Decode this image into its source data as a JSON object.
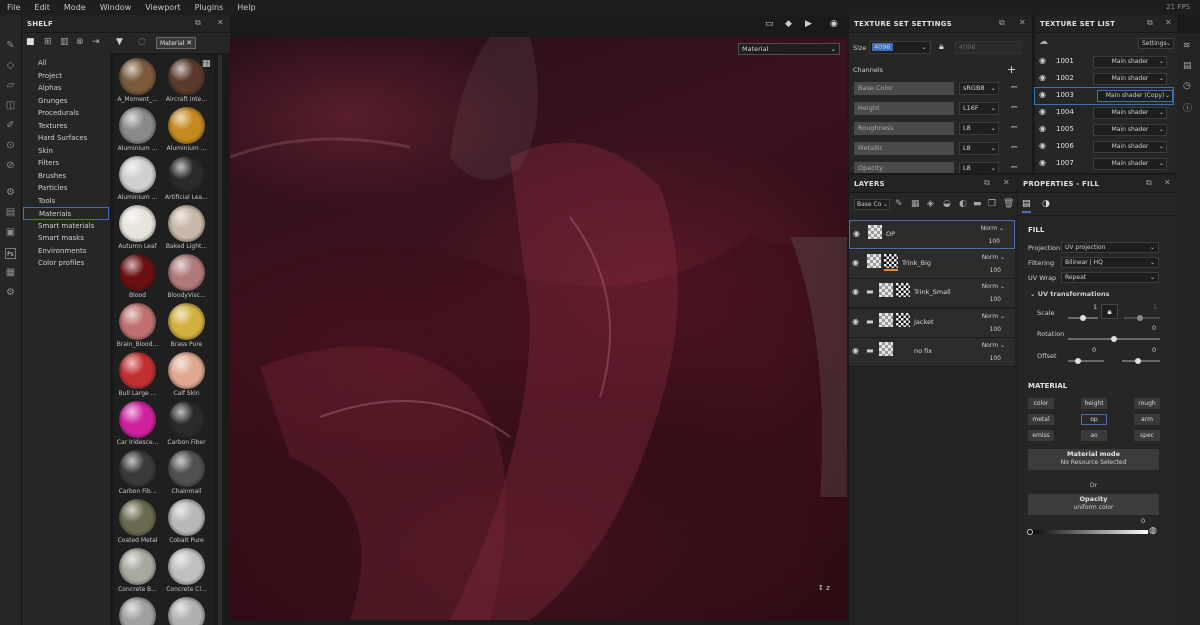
{
  "menu": [
    "File",
    "Edit",
    "Mode",
    "Window",
    "Viewport",
    "Plugins",
    "Help"
  ],
  "fps": "21 FPS",
  "shelf": {
    "title": "SHELF",
    "filter_tag": "Material",
    "categories": [
      "All",
      "Project",
      "Alphas",
      "Grunges",
      "Procedurals",
      "Textures",
      "Hard Surfaces",
      "Skin",
      "Filters",
      "Brushes",
      "Particles",
      "Tools",
      "Materials",
      "Smart materials",
      "Smart masks",
      "Environments",
      "Color profiles"
    ],
    "selected_category": "Materials",
    "materials": [
      {
        "name": "A_Moment_...",
        "color": "#7a5a3a"
      },
      {
        "name": "Aircraft Inte...",
        "color": "#5a3a2a"
      },
      {
        "name": "Aluminium ...",
        "color": "#8a8a8a"
      },
      {
        "name": "Aluminium ...",
        "color": "#c48a20"
      },
      {
        "name": "Aluminium ...",
        "color": "#d0d0d0"
      },
      {
        "name": "Artificial Lea...",
        "color": "#2a2a2a"
      },
      {
        "name": "Autumn Leaf",
        "color": "#e8e4dc"
      },
      {
        "name": "Baked Light...",
        "color": "#c8b8a8"
      },
      {
        "name": "Blood",
        "color": "#6a1010"
      },
      {
        "name": "BloodyVisc...",
        "color": "#b07a7a"
      },
      {
        "name": "Brain_Blood...",
        "color": "#c07070"
      },
      {
        "name": "Brass Pure",
        "color": "#d4b040"
      },
      {
        "name": "Bull Large ...",
        "color": "#c03030"
      },
      {
        "name": "Calf Skin",
        "color": "#e0a890"
      },
      {
        "name": "Car Iridesce...",
        "color": "#d020a0"
      },
      {
        "name": "Carbon Fiber",
        "color": "#2a2a2a"
      },
      {
        "name": "Carbon Fib...",
        "color": "#3a3a3a"
      },
      {
        "name": "Chainmail",
        "color": "#505050"
      },
      {
        "name": "Coated Metal",
        "color": "#6a6a50"
      },
      {
        "name": "Cobalt Pure",
        "color": "#b8b8b8"
      },
      {
        "name": "Concrete B...",
        "color": "#a8a8a0"
      },
      {
        "name": "Concrete Cl...",
        "color": "#c0c0c0"
      },
      {
        "name": "",
        "color": "#a0a0a0"
      },
      {
        "name": "",
        "color": "#b0b0b0"
      }
    ]
  },
  "viewport": {
    "channel": "Material"
  },
  "texture_set_settings": {
    "title": "TEXTURE SET SETTINGS",
    "size_label": "Size",
    "size_value": "4096",
    "size_linked": "4096",
    "channels_label": "Channels",
    "channels": [
      {
        "name": "Base Color",
        "format": "sRGB8"
      },
      {
        "name": "Height",
        "format": "L16F"
      },
      {
        "name": "Roughness",
        "format": "L8"
      },
      {
        "name": "Metallic",
        "format": "L8"
      },
      {
        "name": "Opacity",
        "format": "L8"
      }
    ]
  },
  "texture_set_list": {
    "title": "TEXTURE SET LIST",
    "settings_label": "Settings",
    "sets": [
      {
        "name": "1001",
        "shader": "Main shader"
      },
      {
        "name": "1002",
        "shader": "Main shader"
      },
      {
        "name": "1003",
        "shader": "Main shader (Copy)"
      },
      {
        "name": "1004",
        "shader": "Main shader"
      },
      {
        "name": "1005",
        "shader": "Main shader"
      },
      {
        "name": "1006",
        "shader": "Main shader"
      },
      {
        "name": "1007",
        "shader": "Main shader"
      }
    ],
    "selected": "1003"
  },
  "layers": {
    "title": "LAYERS",
    "channel_select": "Base Co",
    "items": [
      {
        "name": "OP",
        "blend": "Norm",
        "opacity": "100",
        "folder": false
      },
      {
        "name": "Trink_Big",
        "blend": "Norm",
        "opacity": "100",
        "folder": false
      },
      {
        "name": "Trink_Small",
        "blend": "Norm",
        "opacity": "100",
        "folder": true
      },
      {
        "name": "Jacket",
        "blend": "Norm",
        "opacity": "100",
        "folder": true
      },
      {
        "name": "no fix",
        "blend": "Norm",
        "opacity": "100",
        "folder": true
      }
    ]
  },
  "properties": {
    "title": "PROPERTIES - FILL",
    "fill_label": "FILL",
    "projection_label": "Projection",
    "projection_value": "UV projection",
    "filtering_label": "Filtering",
    "filtering_value": "Bilinear | HQ",
    "uvwrap_label": "UV Wrap",
    "uvwrap_value": "Repeat",
    "uvtransform_label": "UV transformations",
    "scale_label": "Scale",
    "scale_value": "1",
    "scale_value_2": "1",
    "rotation_label": "Rotation",
    "rotation_value": "0",
    "offset_label": "Offset",
    "offset_x": "0",
    "offset_y": "0",
    "material_label": "MATERIAL",
    "channel_buttons": [
      "color",
      "height",
      "rough",
      "metal",
      "op",
      "arm",
      "emiss",
      "ao",
      "spec"
    ],
    "selected_channel": "op",
    "material_mode_label": "Material mode",
    "material_mode_value": "No Resource Selected",
    "or_label": "Or",
    "opacity_label": "Opacity",
    "opacity_sub": "uniform color",
    "opacity_value": "0"
  }
}
